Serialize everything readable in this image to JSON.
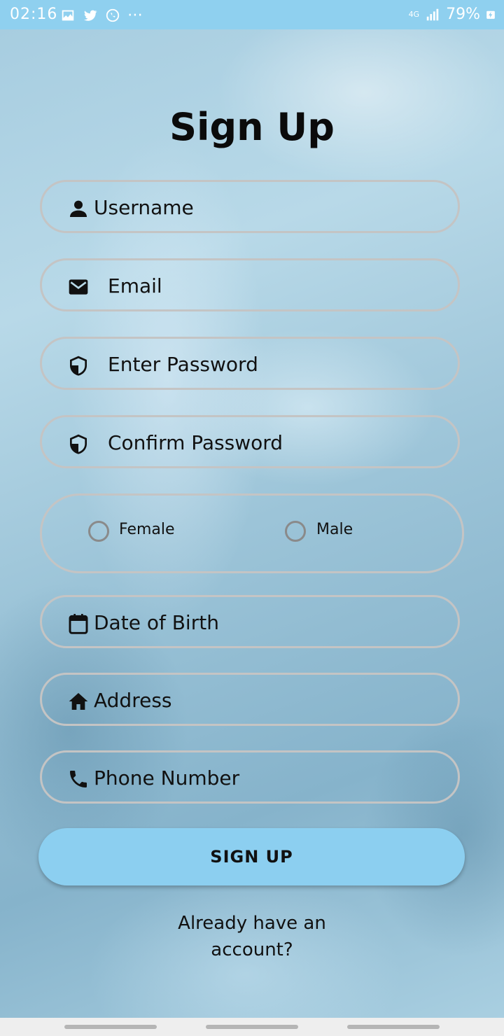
{
  "status_bar": {
    "time": "02:16",
    "network": "4G",
    "battery": "79%",
    "left_icons": [
      "gallery-icon",
      "twitter-icon",
      "whatsapp-icon",
      "more-icon"
    ],
    "right_icons": [
      "signal-icon",
      "battery-charging-icon"
    ],
    "bg_color": "#8fd0ef"
  },
  "title": "Sign Up",
  "fields": {
    "username": {
      "placeholder": "Username",
      "icon": "person-icon"
    },
    "email": {
      "placeholder": "Email",
      "icon": "mail-icon"
    },
    "password": {
      "placeholder": "Enter Password",
      "icon": "shield-icon"
    },
    "confirm_password": {
      "placeholder": "Confirm Password",
      "icon": "shield-icon"
    },
    "dob": {
      "placeholder": "Date of Birth",
      "icon": "calendar-icon"
    },
    "address": {
      "placeholder": "Address",
      "icon": "home-icon"
    },
    "phone": {
      "placeholder": "Phone Number",
      "icon": "phone-icon"
    }
  },
  "gender": {
    "options": [
      "Female",
      "Male"
    ],
    "selected": null
  },
  "signup_button": "SIGN UP",
  "login_link": "Already have an account?",
  "colors": {
    "accent": "#8ccff0",
    "field_border": "#c4c4c4"
  }
}
